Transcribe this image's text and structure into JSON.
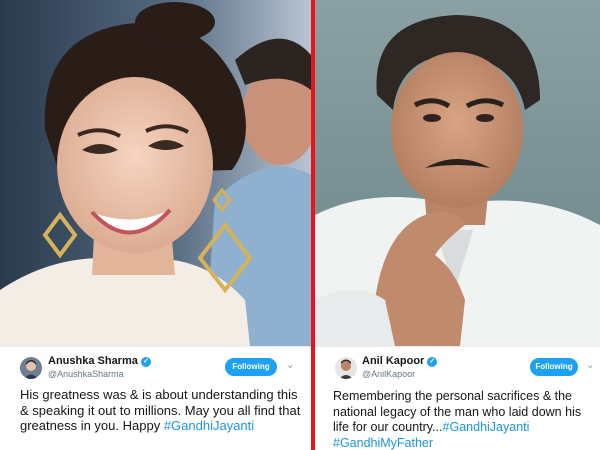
{
  "left_tweet": {
    "name": "Anushka Sharma",
    "handle": "@AnushkaSharma",
    "follow_label": "Following",
    "text": "His greatness was & is about understanding this & speaking it out to millions. May you all find that greatness in you. Happy ",
    "hashtag": "#GandhiJayanti"
  },
  "right_tweet": {
    "name": "Anil Kapoor",
    "handle": "@AnilKapoor",
    "follow_label": "Following",
    "text": "Remembering the personal sacrifices & the national legacy of the man who laid down his life for our country...",
    "hashtag_1": "#GandhiJayanti",
    "hashtag_2": "#GandhiMyFather"
  },
  "colors": {
    "divider": "#e8141b",
    "accent": "#1da1f2",
    "hashtag": "#1b95e0"
  }
}
